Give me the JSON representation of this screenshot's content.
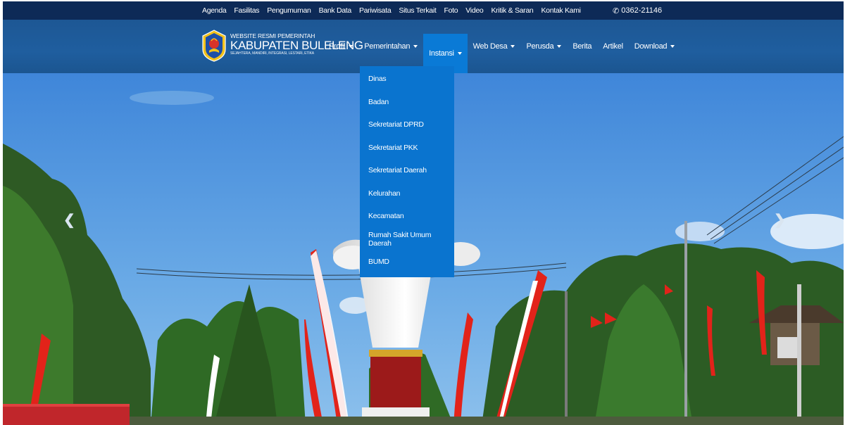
{
  "topbar": {
    "links": [
      "Agenda",
      "Fasilitas",
      "Pengumuman",
      "Bank Data",
      "Pariwisata",
      "Situs Terkait",
      "Foto",
      "Video",
      "Kritik & Saran",
      "Kontak Kami"
    ],
    "phone": "0362-21146"
  },
  "brand": {
    "line1": "WEBSITE RESMI PEMERINTAH",
    "line2": "KABUPATEN BULELENG",
    "line3": "SEJAHTERA, MANDIRI, INTEGRASI, LESTARI, ETIKA"
  },
  "nav": {
    "items": [
      {
        "label": "Profil",
        "has_caret": true
      },
      {
        "label": "Pemerintahan",
        "has_caret": true
      },
      {
        "label": "Instansi",
        "has_caret": true,
        "active": true
      },
      {
        "label": "Web Desa",
        "has_caret": true
      },
      {
        "label": "Perusda",
        "has_caret": true
      },
      {
        "label": "Berita",
        "has_caret": false
      },
      {
        "label": "Artikel",
        "has_caret": false
      },
      {
        "label": "Download",
        "has_caret": true
      }
    ]
  },
  "dropdown": {
    "items": [
      "Dinas",
      "Badan",
      "Sekretariat DPRD",
      "Sekretariat PKK",
      "Sekretariat Daerah",
      "Kelurahan",
      "Kecamatan",
      "Rumah Sakit Umum Daerah",
      "BUMD"
    ]
  },
  "hero": {
    "prev_icon": "chevron-left-icon",
    "next_icon": "chevron-right-icon"
  },
  "colors": {
    "topbar": "#0d2a57",
    "navbar": "#1f5e9f",
    "active": "#0a7ad6",
    "sky": "#5a9be0"
  }
}
